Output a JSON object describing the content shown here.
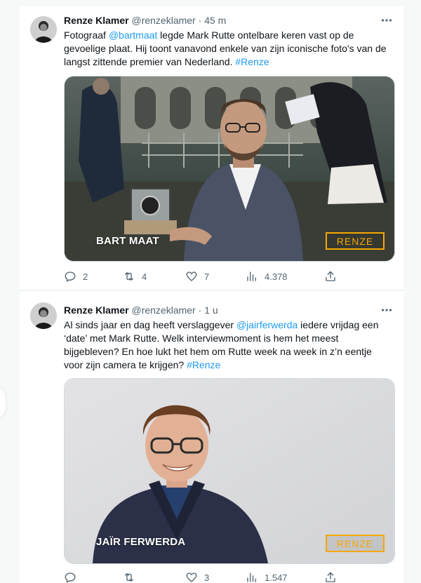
{
  "tweets": [
    {
      "author_name": "Renze Klamer",
      "handle": "@renzeklamer",
      "separator": "·",
      "time": "45 m",
      "text_parts": {
        "t1": "Fotograaf ",
        "mention1": "@bartmaat",
        "t2": " legde Mark Rutte ontelbare keren vast op de gevoelige plaat. Hij toont vanavond enkele van zijn iconische foto's van de langst zittende premier van Nederland. ",
        "hashtag": "#Renze"
      },
      "media": {
        "caption": "BART MAAT",
        "brand": "RENZE"
      },
      "stats": {
        "replies": "2",
        "retweets": "4",
        "likes": "7",
        "views": "4.378"
      }
    },
    {
      "author_name": "Renze Klamer",
      "handle": "@renzeklamer",
      "separator": "·",
      "time": "1 u",
      "text_parts": {
        "t1": "Al sinds jaar en dag heeft verslaggever ",
        "mention1": "@jairferwerda",
        "t2": " iedere vrijdag een ‘date’ met Mark Rutte. Welk interviewmoment is hem het meest bijgebleven? En hoe lukt het hem om Rutte week na week in z’n eentje voor zijn camera te krijgen? ",
        "hashtag": "#Renze"
      },
      "media": {
        "caption": "JAÏR FERWERDA",
        "brand": "RENZE"
      },
      "stats": {
        "replies": "",
        "retweets": "",
        "likes": "3",
        "views": "1.547"
      }
    }
  ],
  "icons": {
    "more": "more-icon",
    "reply": "reply-icon",
    "retweet": "retweet-icon",
    "like": "heart-icon",
    "views": "views-icon",
    "share": "share-icon"
  },
  "colors": {
    "link": "#1d9bf0",
    "muted": "#536471",
    "brand": "#f6a800"
  }
}
